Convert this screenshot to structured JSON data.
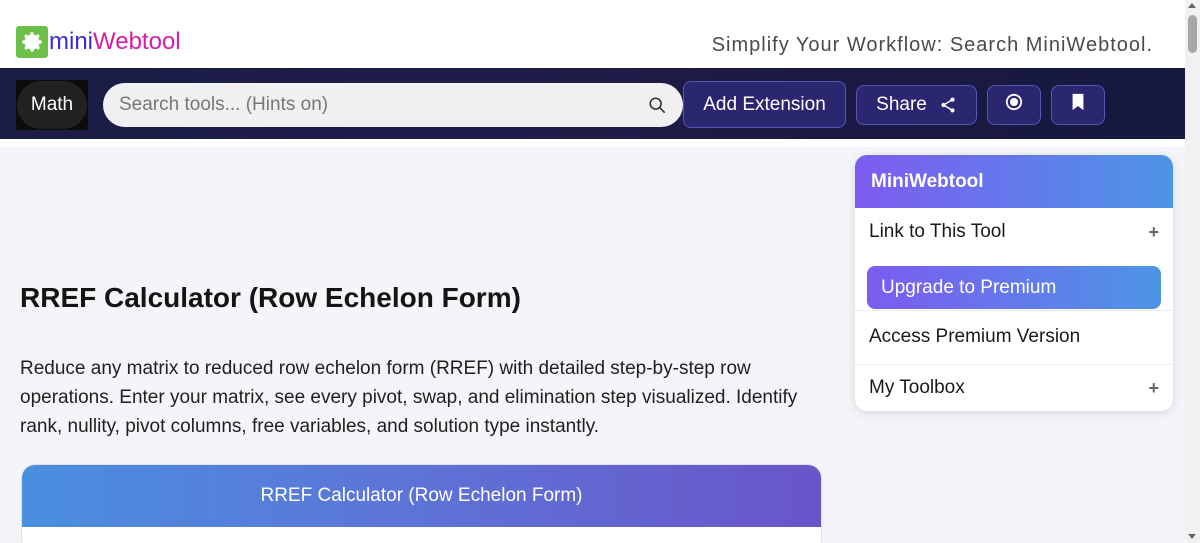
{
  "header": {
    "logo_mini": "mini",
    "logo_web": "Webtool",
    "tagline": "Simplify Your Workflow: Search MiniWebtool."
  },
  "nav": {
    "math_label": "Math",
    "search_placeholder": "Search tools... (Hints on)",
    "add_extension_label": "Add Extension",
    "share_label": "Share",
    "icons": [
      "search-icon",
      "share-icon",
      "record-icon",
      "bookmark-icon"
    ]
  },
  "main": {
    "title": "RREF Calculator (Row Echelon Form)",
    "description": "Reduce any matrix to reduced row echelon form (RREF) with detailed step-by-step row operations. Enter your matrix, see every pivot, swap, and elimination step visualized. Identify rank, nullity, pivot columns, free variables, and solution type instantly.",
    "calculator_title": "RREF Calculator (Row Echelon Form)"
  },
  "sidebar": {
    "title": "MiniWebtool",
    "link_label": "Link to This Tool",
    "premium_label": "Upgrade to Premium",
    "access_label": "Access Premium Version",
    "toolbox_label": "My Toolbox",
    "expand_symbol": "+"
  },
  "colors": {
    "logo_green": "#6cc04a",
    "logo_blue": "#3a2bd0",
    "logo_magenta": "#d21fa5",
    "navbar": "#1b1d47",
    "gradient_start": "#7c5cf0",
    "gradient_end": "#4d95e6"
  }
}
